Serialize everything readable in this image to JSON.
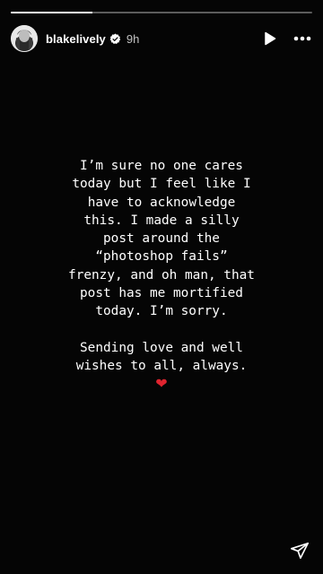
{
  "story": {
    "progress": 0.27,
    "progress_color": "#ffffff",
    "background": "#050505"
  },
  "header": {
    "username": "blakelively",
    "timestamp": "9h",
    "verified": true,
    "icons": {
      "avatar": "avatar",
      "verified": "verified-badge-icon",
      "play": "play-icon",
      "more": "more-icon"
    }
  },
  "content": {
    "lines": [
      "I’m sure no one cares",
      "today but I feel like I",
      "have to acknowledge",
      "this. I made a silly",
      "post around the",
      "“photoshop fails”",
      "frenzy, and oh man, that",
      "post has me mortified",
      "today. I’m sorry."
    ],
    "closing_lines": [
      "Sending love and well",
      "wishes to all, always."
    ],
    "heart": "❤",
    "heart_color": "#e0242f"
  },
  "footer": {
    "icons": {
      "send": "send-icon"
    }
  }
}
